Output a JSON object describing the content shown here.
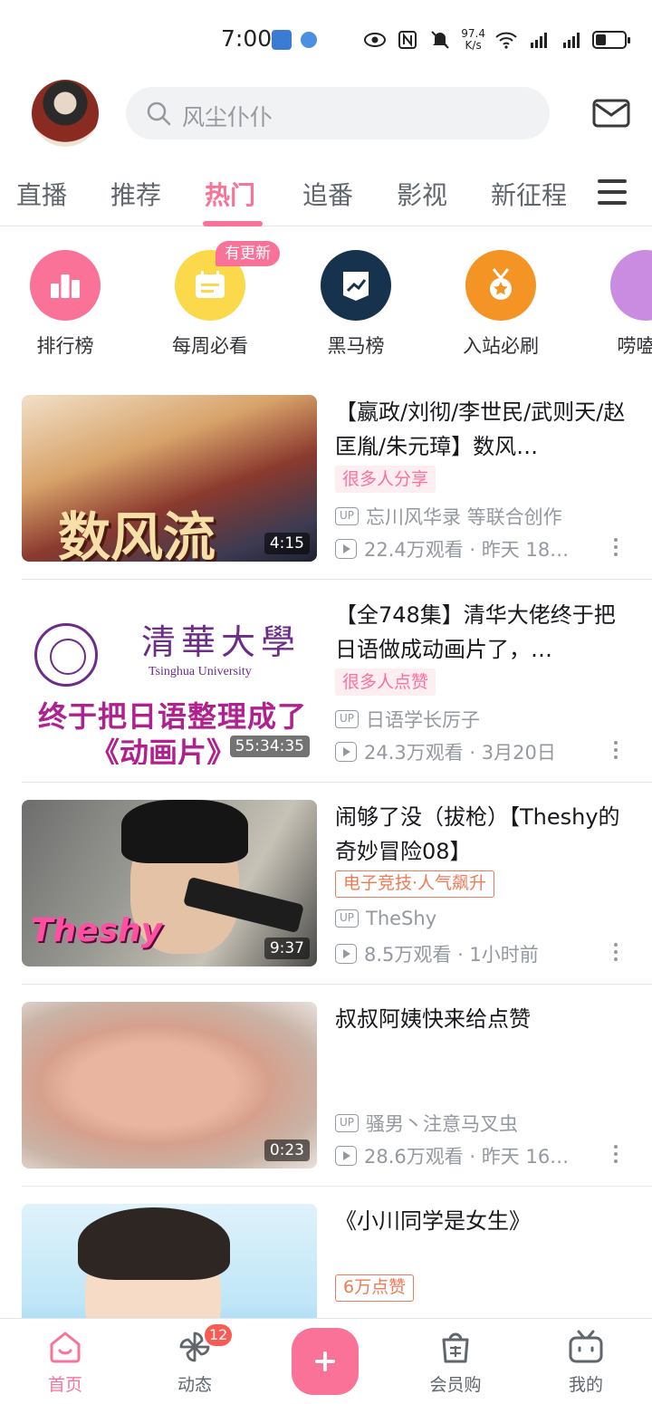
{
  "status_bar": {
    "time": "7:00",
    "net_speed_value": "97.4",
    "net_speed_unit": "K/s",
    "signal1_label": "4G",
    "signal2_label": "4G"
  },
  "header": {
    "search_placeholder": "风尘仆仆"
  },
  "tabs": [
    {
      "label": "直播"
    },
    {
      "label": "推荐"
    },
    {
      "label": "热门"
    },
    {
      "label": "追番"
    },
    {
      "label": "影视"
    },
    {
      "label": "新征程"
    }
  ],
  "active_tab": "热门",
  "quick_entries": [
    {
      "label": "排行榜",
      "color": "#fb7299",
      "icon": "ranking-icon"
    },
    {
      "label": "每周必看",
      "color": "#fcd94a",
      "icon": "calendar-icon"
    },
    {
      "label": "黑马榜",
      "color": "#17324d",
      "icon": "trend-card-icon"
    },
    {
      "label": "入站必刷",
      "color": "#f39424",
      "icon": "medal-icon"
    },
    {
      "label": "唠嗑屋",
      "color": "#c98ce0",
      "icon": "chat-icon"
    }
  ],
  "update_badge": "有更新",
  "videos": [
    {
      "title": "【嬴政/刘彻/李世民/武则天/赵匡胤/朱元璋】数风…",
      "tag": "很多人分享",
      "tag_style": "fill",
      "uploader": "忘川风华录 等联合创作",
      "stats": "22.4万观看 · 昨天 18…",
      "duration": "4:15",
      "thumb_text": "数风流"
    },
    {
      "title": "【全748集】清华大佬终于把日语做成动画片了，…",
      "tag": "很多人点赞",
      "tag_style": "fill",
      "uploader": "日语学长厉子",
      "stats": "24.3万观看 · 3月20日",
      "duration": "55:34:35",
      "thumb_cn": "清華大學",
      "thumb_en": "Tsinghua University",
      "thumb_line1": "终于把日语整理成了",
      "thumb_line2": "《动画片》"
    },
    {
      "title": "闹够了没（拔枪）【Theshy的奇妙冒险08】",
      "tag": "电子竞技·人气飙升",
      "tag_style": "outline",
      "uploader": "TheShy",
      "stats": "8.5万观看 · 1小时前",
      "duration": "9:37",
      "thumb_text": "Theshy"
    },
    {
      "title": "叔叔阿姨快来给点赞",
      "tag": "",
      "tag_style": "none",
      "uploader": "骚男丶注意马叉虫",
      "stats": "28.6万观看 · 昨天 16…",
      "duration": "0:23"
    },
    {
      "title": "《小川同学是女生》",
      "tag": "6万点赞",
      "tag_style": "outline",
      "uploader": "",
      "stats": "",
      "duration": ""
    }
  ],
  "up_label": "UP",
  "bottom_nav": {
    "home": "首页",
    "dynamic": "动态",
    "dynamic_badge": "12",
    "shop": "会员购",
    "mine": "我的"
  },
  "colors": {
    "accent": "#fb7299",
    "text_secondary": "#9499a0"
  }
}
